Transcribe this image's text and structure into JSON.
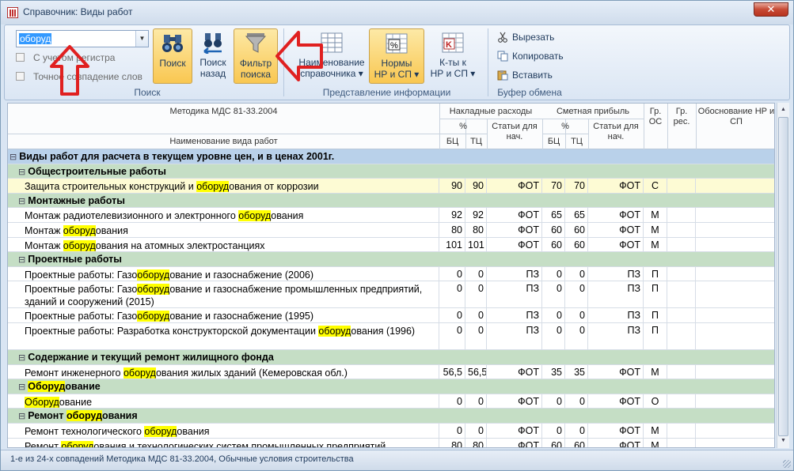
{
  "window": {
    "title": "Справочник: Виды работ",
    "close_label": "✕"
  },
  "ribbon": {
    "search_value": "оборуд",
    "checkbox_case": "С учетом регистра",
    "checkbox_exact": "Точное совпадение слов",
    "btn_search": "Поиск",
    "btn_back_1": "Поиск",
    "btn_back_2": "назад",
    "btn_filter_1": "Фильтр",
    "btn_filter_2": "поиска",
    "btn_name_1": "Наименование",
    "btn_name_2": "справочника ▾",
    "btn_norms_1": "Нормы",
    "btn_norms_2": "НР и СП ▾",
    "btn_coef_1": "К-ты к",
    "btn_coef_2": "НР и СП ▾",
    "btn_cut": "Вырезать",
    "btn_copy": "Копировать",
    "btn_paste": "Вставить",
    "group_search": "Поиск",
    "group_view": "Представление информации",
    "group_clipboard": "Буфер обмена"
  },
  "grid": {
    "header": {
      "method": "Методика МДС 81-33.2004",
      "name": "Наименование вида работ",
      "overhead": "Накладные расходы",
      "profit": "Сметная прибыль",
      "pct": "%",
      "bc": "БЦ",
      "tc": "ТЦ",
      "articles": "Статьи для нач.",
      "gr_os": "Гр. ОС",
      "gr_res": "Гр. рес.",
      "basis": "Обоснование НР и СП"
    },
    "rows": [
      {
        "type": "group0",
        "name": [
          [
            "Виды работ для расчета в текущем уровне цен, и в ценах 2001г.",
            false
          ]
        ]
      },
      {
        "type": "group1",
        "name": [
          [
            "Общестроительные работы",
            false
          ]
        ]
      },
      {
        "type": "sel",
        "name": [
          [
            "Защита строительных конструкций и ",
            false
          ],
          [
            "оборуд",
            true
          ],
          [
            "ования от коррозии",
            false
          ]
        ],
        "bc": "90",
        "tc": "90",
        "art": "ФОТ",
        "pbc": "70",
        "ptc": "70",
        "part": "ФОТ",
        "os": "С"
      },
      {
        "type": "group1",
        "name": [
          [
            "Монтажные работы",
            false
          ]
        ]
      },
      {
        "type": "row",
        "name": [
          [
            "Монтаж радиотелевизионного и электронного ",
            false
          ],
          [
            "оборуд",
            true
          ],
          [
            "ования",
            false
          ]
        ],
        "bc": "92",
        "tc": "92",
        "art": "ФОТ",
        "pbc": "65",
        "ptc": "65",
        "part": "ФОТ",
        "os": "М"
      },
      {
        "type": "row",
        "name": [
          [
            "Монтаж ",
            false
          ],
          [
            "оборуд",
            true
          ],
          [
            "ования",
            false
          ]
        ],
        "bc": "80",
        "tc": "80",
        "art": "ФОТ",
        "pbc": "60",
        "ptc": "60",
        "part": "ФОТ",
        "os": "М"
      },
      {
        "type": "row",
        "name": [
          [
            "Монтаж ",
            false
          ],
          [
            "оборуд",
            true
          ],
          [
            "ования на атомных электростанциях",
            false
          ]
        ],
        "bc": "101",
        "tc": "101",
        "art": "ФОТ",
        "pbc": "60",
        "ptc": "60",
        "part": "ФОТ",
        "os": "М"
      },
      {
        "type": "group1",
        "name": [
          [
            "Проектные работы",
            false
          ]
        ]
      },
      {
        "type": "row",
        "name": [
          [
            "Проектные работы: Газо",
            false
          ],
          [
            "оборуд",
            true
          ],
          [
            "ование и газоснабжение (2006)",
            false
          ]
        ],
        "bc": "0",
        "tc": "0",
        "art": "ПЗ",
        "pbc": "0",
        "ptc": "0",
        "part": "ПЗ",
        "os": "П"
      },
      {
        "type": "row2",
        "name": [
          [
            "Проектные работы: Газо",
            false
          ],
          [
            "оборуд",
            true
          ],
          [
            "ование и газоснабжение промышленных предприятий, зданий и сооружений (2015)",
            false
          ]
        ],
        "bc": "0",
        "tc": "0",
        "art": "ПЗ",
        "pbc": "0",
        "ptc": "0",
        "part": "ПЗ",
        "os": "П"
      },
      {
        "type": "row",
        "name": [
          [
            "Проектные работы: Газо",
            false
          ],
          [
            "оборуд",
            true
          ],
          [
            "ование и газоснабжение (1995)",
            false
          ]
        ],
        "bc": "0",
        "tc": "0",
        "art": "ПЗ",
        "pbc": "0",
        "ptc": "0",
        "part": "ПЗ",
        "os": "П"
      },
      {
        "type": "row2",
        "name": [
          [
            "Проектные работы: Разработка конструкторской документации ",
            false
          ],
          [
            "оборуд",
            true
          ],
          [
            "ования (1996)",
            false
          ]
        ],
        "bc": "0",
        "tc": "0",
        "art": "ПЗ",
        "pbc": "0",
        "ptc": "0",
        "part": "ПЗ",
        "os": "П"
      },
      {
        "type": "group1",
        "name": [
          [
            "Содержание и текущий ремонт жилищного фонда",
            false
          ]
        ]
      },
      {
        "type": "row",
        "name": [
          [
            "Ремонт инженерного ",
            false
          ],
          [
            "оборуд",
            true
          ],
          [
            "ования жилых зданий (Кемеровская обл.)",
            false
          ]
        ],
        "bc": "56,5",
        "tc": "56,5",
        "art": "ФОТ",
        "pbc": "35",
        "ptc": "35",
        "part": "ФОТ",
        "os": "М"
      },
      {
        "type": "group1",
        "name": [
          [
            "Оборуд",
            true
          ],
          [
            "ование",
            false
          ]
        ]
      },
      {
        "type": "row",
        "name": [
          [
            "Оборуд",
            true
          ],
          [
            "ование",
            false
          ]
        ],
        "bc": "0",
        "tc": "0",
        "art": "ФОТ",
        "pbc": "0",
        "ptc": "0",
        "part": "ФОТ",
        "os": "О"
      },
      {
        "type": "group1",
        "name": [
          [
            "Ремонт ",
            false
          ],
          [
            "оборуд",
            true
          ],
          [
            "ования",
            false
          ]
        ]
      },
      {
        "type": "row",
        "name": [
          [
            "Ремонт технологического ",
            false
          ],
          [
            "оборуд",
            true
          ],
          [
            "ования",
            false
          ]
        ],
        "bc": "0",
        "tc": "0",
        "art": "ФОТ",
        "pbc": "0",
        "ptc": "0",
        "part": "ФОТ",
        "os": "М"
      },
      {
        "type": "row",
        "name": [
          [
            "Ремонт ",
            false
          ],
          [
            "оборуд",
            true
          ],
          [
            "ования и технологических систем промышленных предприятий",
            false
          ]
        ],
        "bc": "80",
        "tc": "80",
        "art": "ФОТ",
        "pbc": "60",
        "ptc": "60",
        "part": "ФОТ",
        "os": "М"
      }
    ]
  },
  "status": {
    "text": "1-е из 24-х совпадений  Методика МДС 81-33.2004, Обычные условия строительства"
  },
  "colors": {
    "highlight": "#ffff00",
    "group0": "#b9d1ea",
    "group1": "#c5dec5",
    "selected": "#fdfbd4",
    "arrow": "#e02020"
  }
}
